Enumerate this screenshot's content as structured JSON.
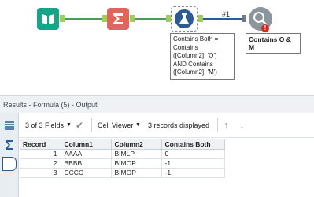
{
  "workflow": {
    "formula_expression": "Contains Both = Contains ([Column2], 'O') AND Contains ([Column2], 'M')",
    "connection_label": "#1",
    "output_tool_label": "Contains O & M",
    "output_error_badge": "!"
  },
  "results": {
    "panel_title": "Results - Formula (5) - Output",
    "fields_summary": "3 of 3 Fields",
    "cell_viewer_label": "Cell Viewer",
    "records_summary": "3 records displayed",
    "columns": [
      "Record",
      "Column1",
      "Column2",
      "Contains Both"
    ],
    "rows": [
      [
        "1",
        "AAAA",
        "BIMLP",
        "0"
      ],
      [
        "2",
        "BBBB",
        "BIMOP",
        "-1"
      ],
      [
        "3",
        "CCCC",
        "BIMOP",
        "-1"
      ]
    ]
  },
  "colors": {
    "input_tool": "#17a589",
    "formula_tool": "#e0655a",
    "formula_tool_selected": "#2c5b93",
    "browse_tool": "#8c959c",
    "error": "#d42b20",
    "connection": "#4e9a5b"
  }
}
